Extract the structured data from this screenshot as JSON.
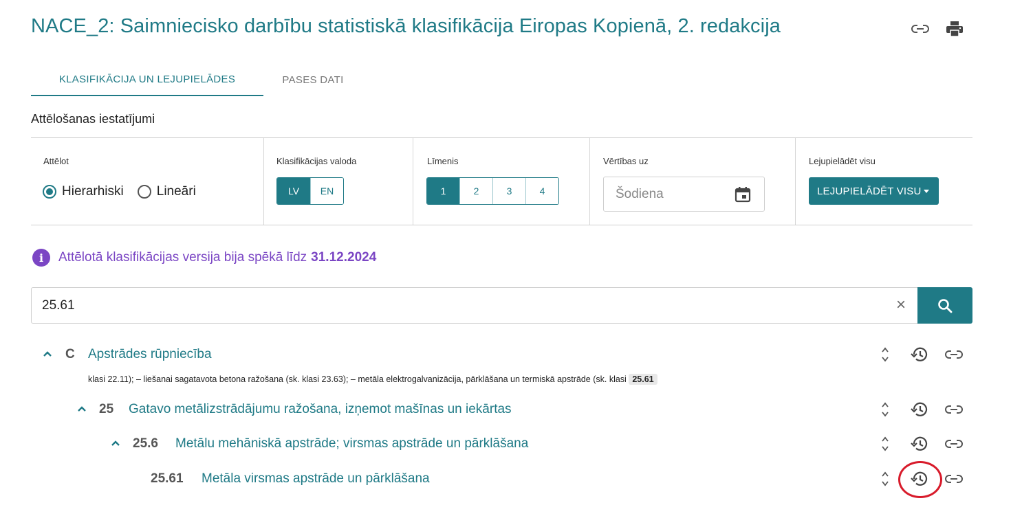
{
  "page": {
    "title": "NACE_2: Saimniecisko darbību statistiskā klasifikācija Eiropas Kopienā, 2. redakcija",
    "header_icons": [
      "link-icon",
      "print-icon"
    ]
  },
  "tabs": [
    {
      "label": "KLASIFIKĀCIJA UN LEJUPIELĀDES",
      "active": true
    },
    {
      "label": "PASES DATI",
      "active": false
    }
  ],
  "settings": {
    "section_title": "Attēlošanas iestatījumi",
    "display": {
      "label": "Attēlot",
      "options": [
        {
          "label": "Hierarhiski",
          "checked": true
        },
        {
          "label": "Lineāri",
          "checked": false
        }
      ]
    },
    "language": {
      "label": "Klasifikācijas valoda",
      "options": [
        {
          "label": "LV",
          "active": true
        },
        {
          "label": "EN",
          "active": false
        }
      ]
    },
    "level": {
      "label": "Līmenis",
      "options": [
        {
          "label": "1",
          "active": true
        },
        {
          "label": "2",
          "active": false
        },
        {
          "label": "3",
          "active": false
        },
        {
          "label": "4",
          "active": false
        }
      ]
    },
    "values_at": {
      "label": "Vērtības uz",
      "placeholder": "Šodiena",
      "icon": "calendar-icon"
    },
    "download": {
      "label": "Lejupielādēt visu",
      "button": "LEJUPIELĀDĒT VISU"
    }
  },
  "notice": {
    "text": "Attēlotā klasifikācijas versija bija spēkā līdz",
    "date": "31.12.2024",
    "color": "#7b46c4"
  },
  "search": {
    "value": "25.61",
    "clear": "×"
  },
  "tree": [
    {
      "code": "C",
      "label": "Apstrādes rūpniecība",
      "expanded": true
    },
    {
      "code": "25",
      "label": "Gatavo metālizstrādājumu ražošana, izņemot mašīnas un iekārtas",
      "expanded": true
    },
    {
      "code": "25.6",
      "label": "Metālu mehāniskā apstrāde; virsmas apstrāde un pārklāšana",
      "expanded": true
    },
    {
      "code": "25.61",
      "label": "Metāla virsmas apstrāde un pārklāšana",
      "expanded": false
    }
  ],
  "snippet": {
    "text": "klasi 22.11); – liešanai sagatavota betona ražošana (sk. klasi 23.63); – metāla elektrogalvanizācija, pārklāšana un termiskā apstrāde (sk. klasi",
    "highlight": "25.61"
  },
  "colors": {
    "accent": "#1f7a86",
    "annotation": "#d81b2b"
  }
}
